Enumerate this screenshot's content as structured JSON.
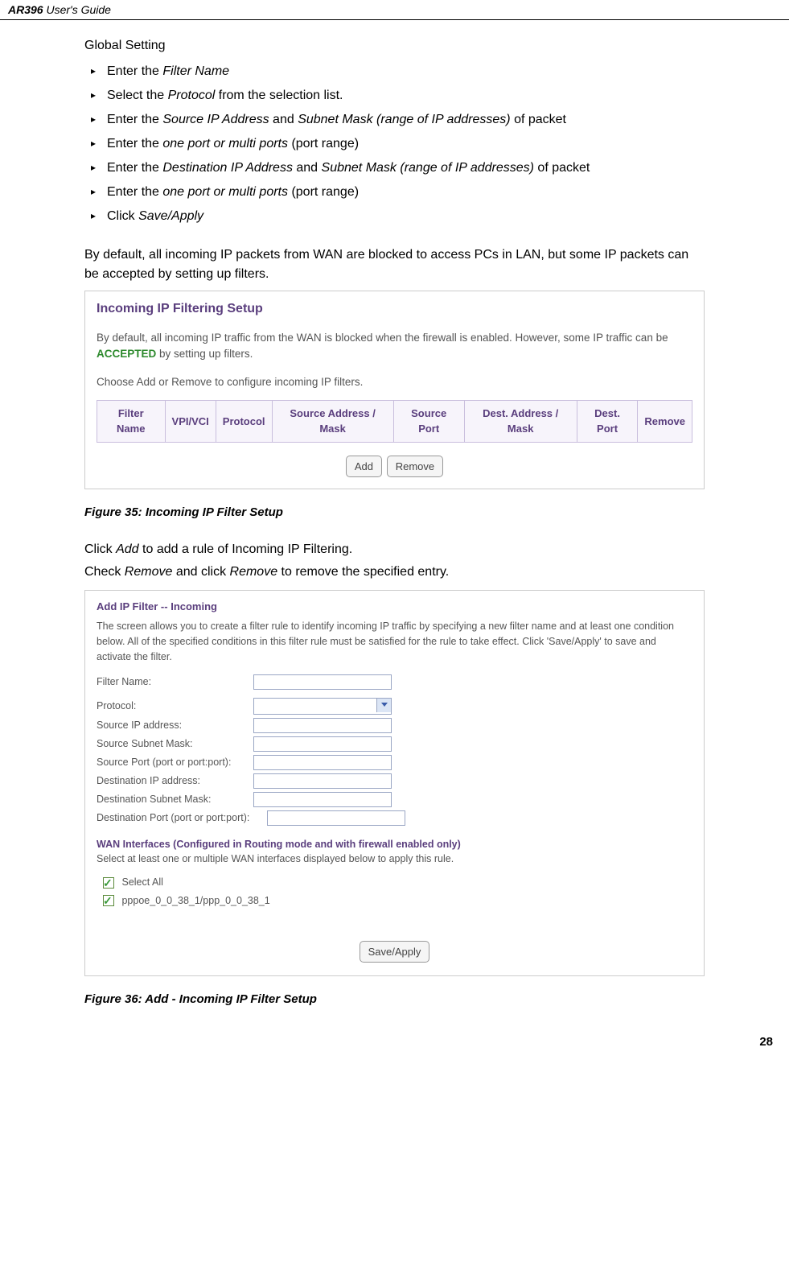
{
  "header": {
    "product": "AR396",
    "suffix": "User's Guide"
  },
  "global_setting_title": "Global Setting",
  "bullets": [
    {
      "pre": "Enter the ",
      "em1": "Filter Name",
      "post": ""
    },
    {
      "pre": "Select the ",
      "em1": "Protocol",
      "post": " from the selection list."
    },
    {
      "pre": "Enter the ",
      "em1": "Source IP Address",
      "mid": " and ",
      "em2": "Subnet Mask (range of IP addresses)",
      "post": " of packet"
    },
    {
      "pre": "Enter the ",
      "em1": "one port or multi ports",
      "post": " (port range)"
    },
    {
      "pre": "Enter the ",
      "em1": "Destination IP Address",
      "mid": " and ",
      "em2": "Subnet Mask (range of IP addresses)",
      "post": " of packet"
    },
    {
      "pre": "Enter the ",
      "em1": "one port or multi ports",
      "post": " (port range)"
    },
    {
      "pre": "Click ",
      "em1": "Save/Apply",
      "post": ""
    }
  ],
  "intro_para": "By default, all incoming IP packets from WAN are blocked to access PCs in LAN, but some IP packets can be accepted by setting up filters.",
  "fig35": {
    "title": "Incoming IP Filtering Setup",
    "line1_pre": "By default, all incoming IP traffic from the WAN is blocked when the firewall is enabled. However, some IP traffic can be ",
    "line1_green": "ACCEPTED",
    "line1_post": " by setting up filters.",
    "line2": "Choose Add or Remove to configure incoming IP filters.",
    "cols": [
      "Filter Name",
      "VPI/VCI",
      "Protocol",
      "Source Address / Mask",
      "Source Port",
      "Dest. Address / Mask",
      "Dest. Port",
      "Remove"
    ],
    "btn_add": "Add",
    "btn_remove": "Remove",
    "caption": "Figure 35: Incoming IP Filter Setup"
  },
  "mid_text": {
    "p1_pre": "Click ",
    "p1_em": "Add",
    "p1_post": " to add a rule of Incoming IP Filtering.",
    "p2_pre": "Check ",
    "p2_em1": "Remove",
    "p2_mid": " and click ",
    "p2_em2": "Remove",
    "p2_post": " to remove the specified entry."
  },
  "fig36": {
    "title": "Add IP Filter -- Incoming",
    "desc": "The screen allows you to create a filter rule to identify incoming IP traffic by specifying a new filter name and at least one condition below. All of the specified conditions in this filter rule must be satisfied for the rule to take effect. Click 'Save/Apply' to save and activate the filter.",
    "fields": [
      "Filter Name:",
      "Protocol:",
      "Source IP address:",
      "Source Subnet Mask:",
      "Source Port (port or port:port):",
      "Destination IP address:",
      "Destination Subnet Mask:",
      "Destination Port (port or port:port):"
    ],
    "wan_title": "WAN Interfaces (Configured in Routing mode and with firewall enabled only)",
    "wan_sub": "Select at least one or multiple WAN interfaces displayed below to apply this rule.",
    "cb1": "Select All",
    "cb2": "pppoe_0_0_38_1/ppp_0_0_38_1",
    "btn_save": "Save/Apply",
    "caption": "Figure 36: Add - Incoming IP Filter Setup"
  },
  "page_number": "28"
}
